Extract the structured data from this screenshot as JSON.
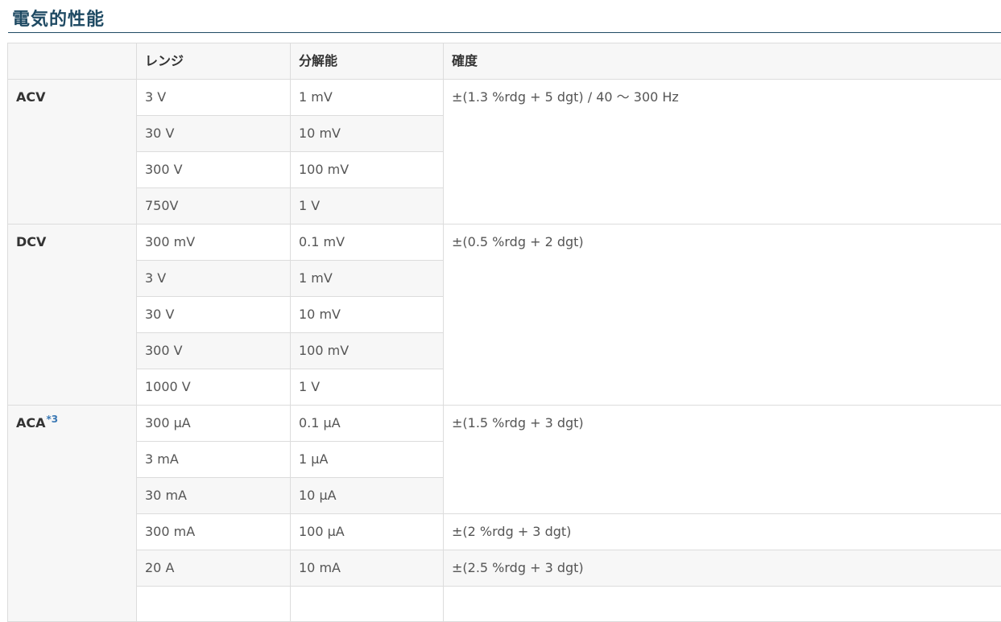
{
  "page": {
    "title": "電気的性能"
  },
  "table": {
    "headers": [
      "",
      "レンジ",
      "分解能",
      "確度"
    ],
    "groups": [
      {
        "label": "ACV",
        "note": "",
        "rows": [
          {
            "range": "3 V",
            "resolution": "1 mV"
          },
          {
            "range": "30 V",
            "resolution": "10 mV"
          },
          {
            "range": "300 V",
            "resolution": "100 mV"
          },
          {
            "range": "750V",
            "resolution": "1 V"
          }
        ],
        "accuracy": [
          "±(1.3 %rdg + 5 dgt) / 40 〜 300 Hz"
        ]
      },
      {
        "label": "DCV",
        "note": "",
        "rows": [
          {
            "range": "300 mV",
            "resolution": "0.1 mV"
          },
          {
            "range": "3 V",
            "resolution": "1 mV"
          },
          {
            "range": "30 V",
            "resolution": "10 mV"
          },
          {
            "range": "300 V",
            "resolution": "100 mV"
          },
          {
            "range": "1000 V",
            "resolution": "1 V"
          }
        ],
        "accuracy": [
          "±(0.5 %rdg + 2 dgt)"
        ]
      },
      {
        "label": "ACA",
        "note": "*3",
        "rows": [
          {
            "range": "300 μA",
            "resolution": "0.1 μA"
          },
          {
            "range": "3 mA",
            "resolution": "1 μA"
          },
          {
            "range": "30 mA",
            "resolution": "10 μA"
          },
          {
            "range": "300 mA",
            "resolution": "100 μA"
          },
          {
            "range": "20 A",
            "resolution": "10 mA"
          }
        ],
        "accuracy": [
          "±(1.5 %rdg + 3 dgt)",
          "±(2 %rdg + 3 dgt)",
          "±(2.5 %rdg + 3 dgt)"
        ]
      }
    ]
  }
}
